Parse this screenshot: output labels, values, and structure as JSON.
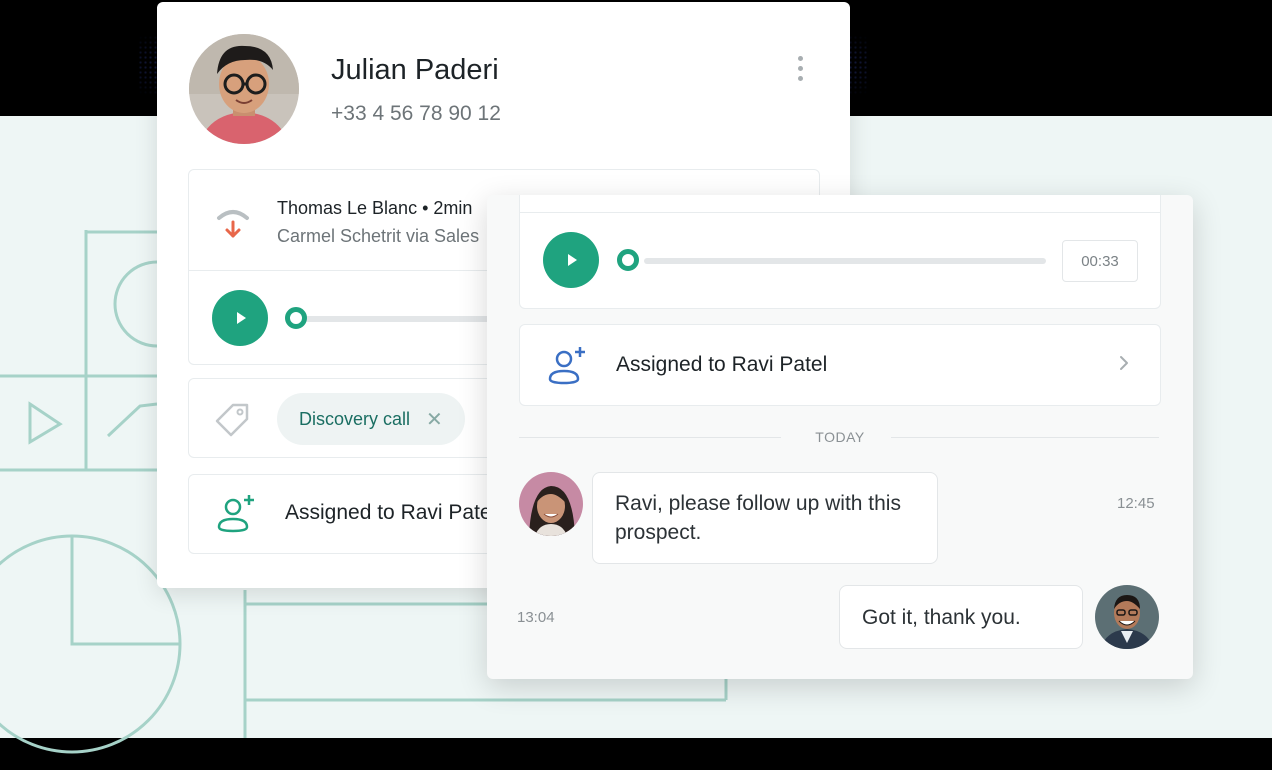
{
  "contact": {
    "name": "Julian Paderi",
    "phone": "+33 4 56 78 90 12"
  },
  "call": {
    "title": "Thomas Le Blanc • 2min",
    "subtitle": "Carmel Schetrit via Sales",
    "icon": "incoming-call-icon"
  },
  "tag": {
    "label": "Discovery call",
    "remove": "✕"
  },
  "assignment": {
    "text": "Assigned to Ravi Patel",
    "icon": "assign-user-icon"
  },
  "player": {
    "duration": "00:33",
    "progress": 0
  },
  "timeline": {
    "divider": "TODAY"
  },
  "messages": [
    {
      "text": "Ravi, please follow up with this prospect.",
      "time": "12:45"
    },
    {
      "text": "Got it, thank you.",
      "time": "13:04"
    }
  ],
  "colors": {
    "accent": "#1fa37f",
    "tag_text": "#1a6e62",
    "missed_call": "#e8674a",
    "background": "#eef6f5"
  }
}
